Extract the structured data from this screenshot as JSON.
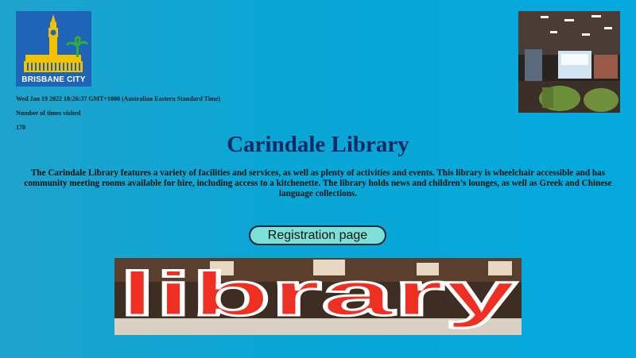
{
  "logo": {
    "text": "BRISBANE CITY"
  },
  "header": {
    "timestamp": "Wed Jan 19 2022 18:26:37 GMT+1000 (Australian Eastern Standard Time)",
    "visits_label": "Number of times visited",
    "visits_count": "178"
  },
  "main": {
    "title": "Carindale Library",
    "description": "The Carindale Library features a variety of facilities and services, as well as plenty of activities and events. This library is wheelchair accessible and has community meeting rooms available for hire, including access to a kitchenette. The library holds news and children’s lounges, as well as Greek and Chinese language collections.",
    "registration_button": "Registration page"
  },
  "banner": {
    "text": "library"
  },
  "colors": {
    "title": "#0d2b63",
    "button_bg": "#7ce0d8",
    "logo_bg": "#1f64b7",
    "logo_gold": "#f2c200"
  }
}
